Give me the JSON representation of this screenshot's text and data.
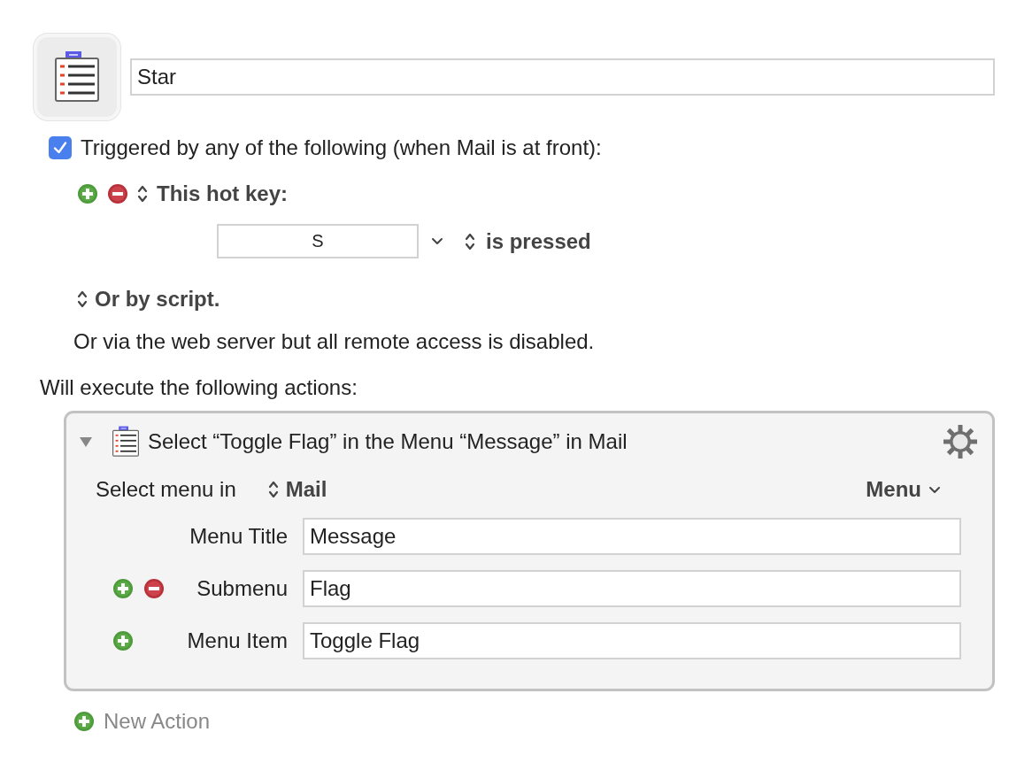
{
  "macro": {
    "name": "Star"
  },
  "trigger": {
    "checked": true,
    "label": "Triggered by any of the following (when Mail is at front):"
  },
  "hotkey": {
    "title": "This hot key:",
    "key": "S",
    "condition": "is pressed"
  },
  "script_trigger": "Or by script.",
  "web_note": "Or via the web server but all remote access is disabled.",
  "actions_heading": "Will execute the following actions:",
  "action": {
    "expanded": true,
    "title": "Select “Toggle Flag” in the Menu “Message” in Mail",
    "target_label": "Select menu in",
    "target": "Mail",
    "menu_button": "Menu",
    "fields": [
      {
        "label": "Menu Title",
        "value": "Message",
        "kind": "fixed"
      },
      {
        "label": "Submenu",
        "value": "Flag",
        "kind": "add_remove"
      },
      {
        "label": "Menu Item",
        "value": "Toggle Flag",
        "kind": "add"
      }
    ]
  },
  "new_action": "New Action"
}
